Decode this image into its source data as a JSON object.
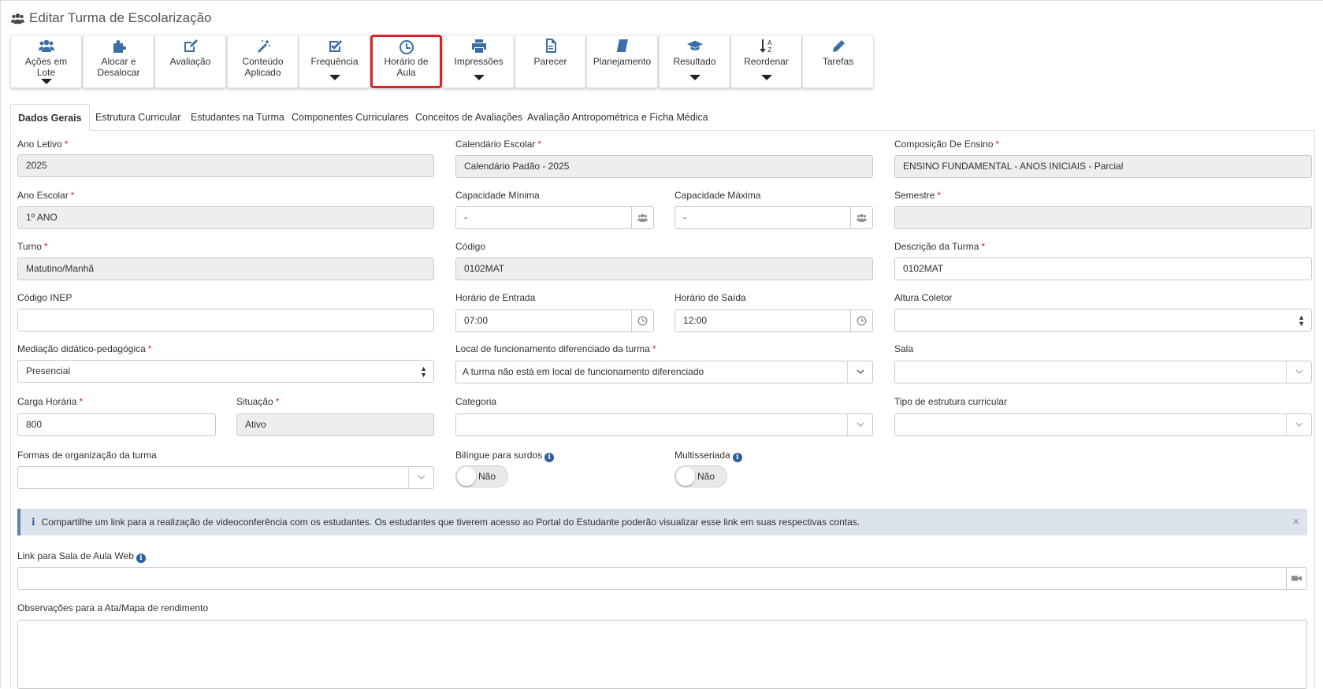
{
  "page": {
    "title": "Editar Turma de Escolarização",
    "title_icon": "users-icon"
  },
  "toolbar": [
    {
      "label": "Ações em Lote",
      "line1": "Ações em",
      "line2": "Lote",
      "icon": "users-icon",
      "dropdown": true
    },
    {
      "label": "Alocar e Desalocar",
      "line1": "Alocar e",
      "line2": "Desalocar",
      "icon": "puzzle-icon",
      "dropdown": false
    },
    {
      "label": "Avaliação",
      "line1": "Avaliação",
      "line2": "",
      "icon": "edit-icon",
      "dropdown": false
    },
    {
      "label": "Conteúdo Aplicado",
      "line1": "Conteúdo",
      "line2": "Aplicado",
      "icon": "magic-wand-icon",
      "dropdown": false
    },
    {
      "label": "Frequência",
      "line1": "Frequência",
      "line2": "",
      "icon": "check-square-icon",
      "dropdown": true
    },
    {
      "label": "Horário de Aula",
      "line1": "Horário de",
      "line2": "Aula",
      "icon": "clock-icon",
      "dropdown": false,
      "highlighted": true
    },
    {
      "label": "Impressões",
      "line1": "Impressões",
      "line2": "",
      "icon": "print-icon",
      "dropdown": true
    },
    {
      "label": "Parecer",
      "line1": "Parecer",
      "line2": "",
      "icon": "file-icon",
      "dropdown": false
    },
    {
      "label": "Planejamento",
      "line1": "Planejamento",
      "line2": "",
      "icon": "book-icon",
      "dropdown": false
    },
    {
      "label": "Resultado",
      "line1": "Resultado",
      "line2": "",
      "icon": "graduation-cap-icon",
      "dropdown": true
    },
    {
      "label": "Reordenar",
      "line1": "Reordenar",
      "line2": "",
      "icon": "sort-alpha-icon",
      "dropdown": true
    },
    {
      "label": "Tarefas",
      "line1": "Tarefas",
      "line2": "",
      "icon": "pencil-icon",
      "dropdown": false
    }
  ],
  "tabs": [
    {
      "label": "Dados Gerais",
      "active": true
    },
    {
      "label": "Estrutura Curricular"
    },
    {
      "label": "Estudantes na Turma"
    },
    {
      "label": "Componentes Curriculares"
    },
    {
      "label": "Conceitos de Avaliações"
    },
    {
      "label": "Avaliação Antropométrica e Ficha Médica"
    }
  ],
  "form": {
    "ano_letivo": {
      "label": "Ano Letivo",
      "value": "2025"
    },
    "calendario": {
      "label": "Calendário Escolar",
      "value": "Calendário Padão - 2025"
    },
    "composicao": {
      "label": "Composição De Ensino",
      "value": "ENSINO FUNDAMENTAL - ANOS INICIAIS - Parcial"
    },
    "ano_escolar": {
      "label": "Ano Escolar",
      "value": "1º ANO"
    },
    "cap_min": {
      "label": "Capacidade Mínima",
      "value": "-"
    },
    "cap_max": {
      "label": "Capacidade Máxima",
      "value": "-"
    },
    "semestre": {
      "label": "Semestre",
      "value": ""
    },
    "turno": {
      "label": "Turno",
      "value": "Matutino/Manhã"
    },
    "codigo": {
      "label": "Código",
      "value": "0102MAT"
    },
    "descricao": {
      "label": "Descrição da Turma",
      "value": "0102MAT"
    },
    "codigo_inep": {
      "label": "Código INEP",
      "value": ""
    },
    "hora_entrada": {
      "label": "Horário de Entrada",
      "value": "07:00"
    },
    "hora_saida": {
      "label": "Horário de Saída",
      "value": "12:00"
    },
    "altura_coletor": {
      "label": "Altura Coletor",
      "value": ""
    },
    "mediacao": {
      "label": "Mediação didático-pedagógica",
      "value": "Presencial"
    },
    "local_func": {
      "label": "Local de funcionamento diferenciado da turma",
      "value": "A turma não está em local de funcionamento diferenciado"
    },
    "sala": {
      "label": "Sala",
      "value": ""
    },
    "carga_horaria": {
      "label": "Carga Horária",
      "value": "800"
    },
    "situacao": {
      "label": "Situação",
      "value": "Ativo"
    },
    "categoria": {
      "label": "Categoria",
      "value": ""
    },
    "tipo_estrutura": {
      "label": "Tipo de estrutura curricular",
      "value": ""
    },
    "formas_org": {
      "label": "Formas de organização da turma",
      "value": ""
    },
    "bilingue": {
      "label": "Bilíngue para surdos",
      "value": "Não"
    },
    "multisseriada": {
      "label": "Multisseriada",
      "value": "Não"
    },
    "link_sala": {
      "label": "Link para Sala de Aula Web",
      "value": ""
    },
    "observacoes": {
      "label": "Observações para a Ata/Mapa de rendimento",
      "value": ""
    }
  },
  "alert": {
    "text": "Compartilhe um link para a realização de videoconferência com os estudantes. Os estudantes que tiverem acesso ao Portal do Estudante poderão visualizar esse link em suas respectivas contas.",
    "close": "×",
    "info": "i"
  },
  "colors": {
    "required": "#d9232d",
    "accent": "#3a6ea5",
    "highlight_border": "#d9232d"
  }
}
